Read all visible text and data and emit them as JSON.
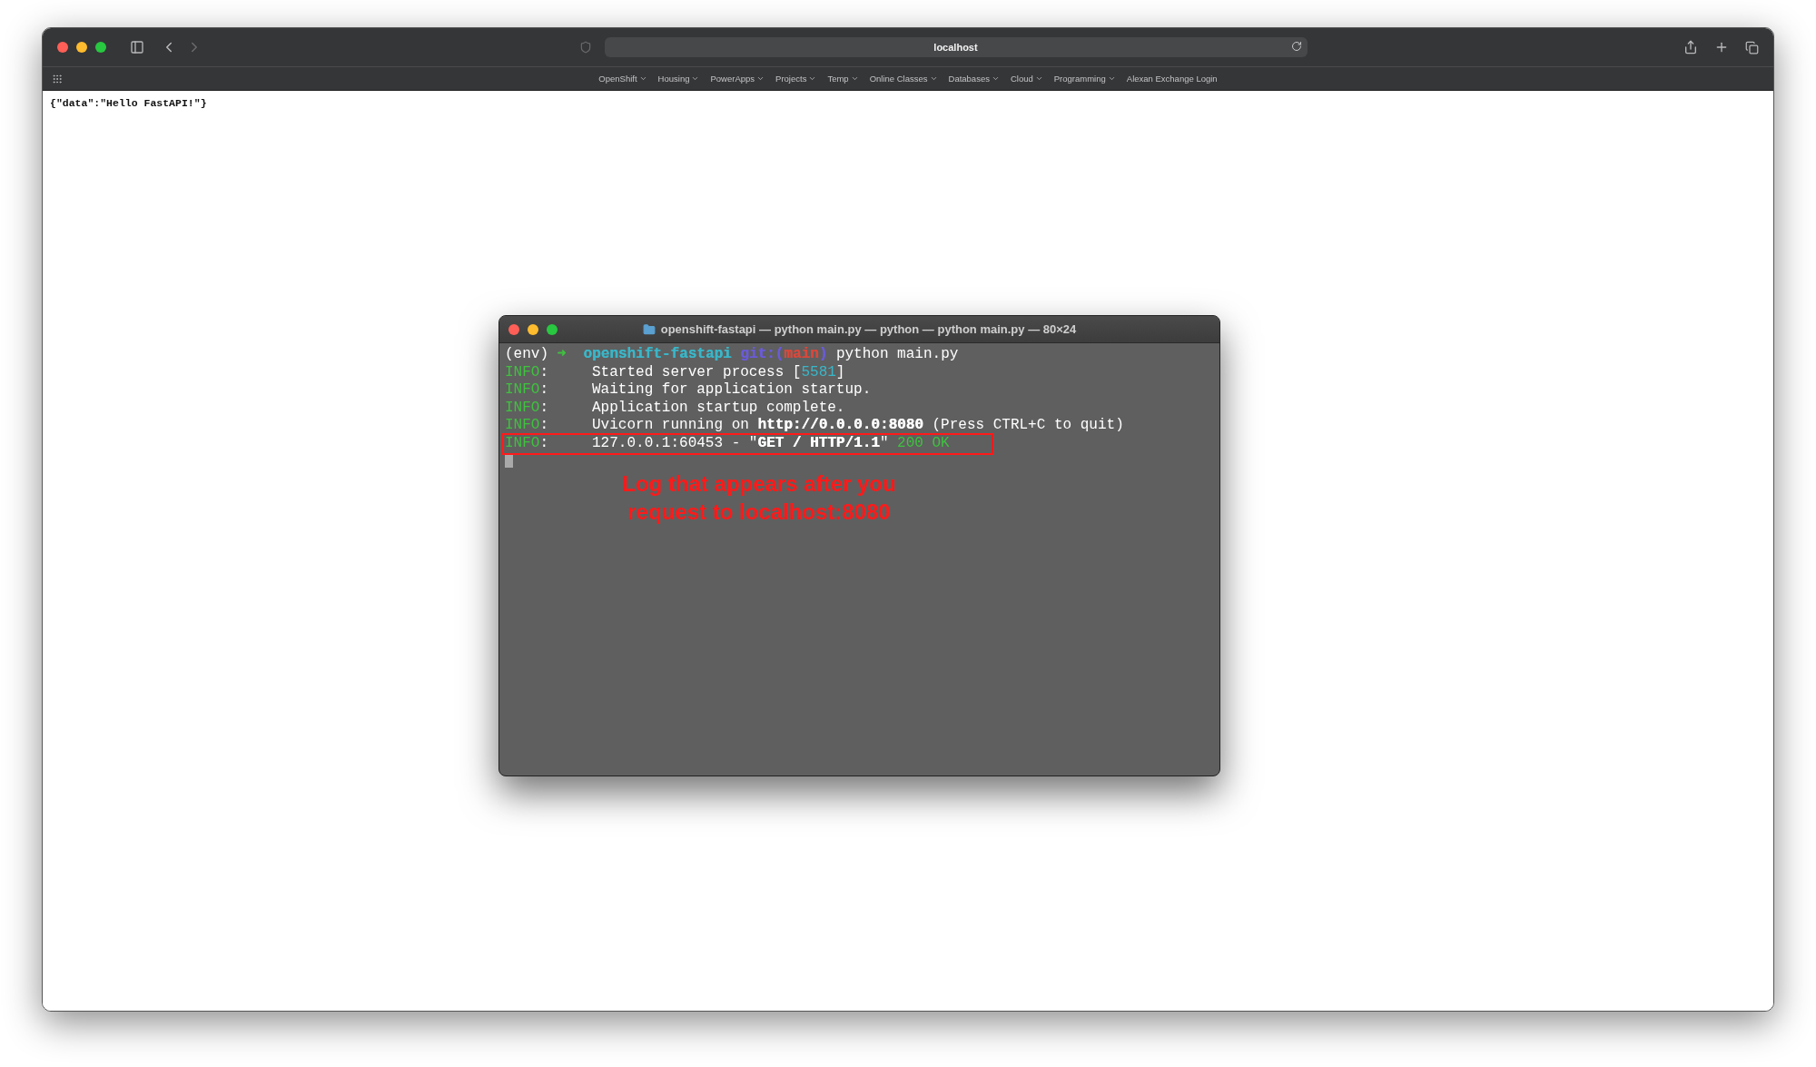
{
  "browser": {
    "url": "localhost",
    "bookmarks": [
      {
        "label": "OpenShift",
        "kind": "folder"
      },
      {
        "label": "Housing",
        "kind": "folder"
      },
      {
        "label": "PowerApps",
        "kind": "folder"
      },
      {
        "label": "Projects",
        "kind": "folder"
      },
      {
        "label": "Temp",
        "kind": "folder"
      },
      {
        "label": "Online Classes",
        "kind": "folder"
      },
      {
        "label": "Databases",
        "kind": "folder"
      },
      {
        "label": "Cloud",
        "kind": "folder"
      },
      {
        "label": "Programming",
        "kind": "folder"
      },
      {
        "label": "Alexan Exchange Login",
        "kind": "link"
      }
    ],
    "page_text": "{\"data\":\"Hello FastAPI!\"}"
  },
  "terminal": {
    "title": "openshift-fastapi — python main.py — python — python main.py — 80×24",
    "lines": [
      {
        "highlighted": false,
        "segments": [
          {
            "text": "(env) ",
            "color": "#ffffff",
            "bold": false
          },
          {
            "text": "➜  ",
            "color": "#3fc23f",
            "bold": true
          },
          {
            "text": "openshift-fastapi ",
            "color": "#3ab6c8",
            "bold": true
          },
          {
            "text": "git:(",
            "color": "#6a5bd8",
            "bold": true
          },
          {
            "text": "main",
            "color": "#d9483b",
            "bold": true
          },
          {
            "text": ") ",
            "color": "#6a5bd8",
            "bold": true
          },
          {
            "text": "python main.py",
            "color": "#ffffff",
            "bold": false
          }
        ]
      },
      {
        "highlighted": false,
        "segments": [
          {
            "text": "INFO",
            "color": "#3fc23f",
            "bold": false
          },
          {
            "text": ":     Started server process [",
            "color": "#ffffff",
            "bold": false
          },
          {
            "text": "5581",
            "color": "#3ab6c8",
            "bold": false
          },
          {
            "text": "]",
            "color": "#ffffff",
            "bold": false
          }
        ]
      },
      {
        "highlighted": false,
        "segments": [
          {
            "text": "INFO",
            "color": "#3fc23f",
            "bold": false
          },
          {
            "text": ":     Waiting for application startup.",
            "color": "#ffffff",
            "bold": false
          }
        ]
      },
      {
        "highlighted": false,
        "segments": [
          {
            "text": "INFO",
            "color": "#3fc23f",
            "bold": false
          },
          {
            "text": ":     Application startup complete.",
            "color": "#ffffff",
            "bold": false
          }
        ]
      },
      {
        "highlighted": false,
        "segments": [
          {
            "text": "INFO",
            "color": "#3fc23f",
            "bold": false
          },
          {
            "text": ":     Uvicorn running on ",
            "color": "#ffffff",
            "bold": false
          },
          {
            "text": "http://0.0.0.0:8080",
            "color": "#ffffff",
            "bold": true
          },
          {
            "text": " (Press CTRL+C to quit)",
            "color": "#ffffff",
            "bold": false
          }
        ]
      },
      {
        "highlighted": true,
        "segments": [
          {
            "text": "INFO",
            "color": "#3fc23f",
            "bold": false
          },
          {
            "text": ":     127.0.0.1:60453 - \"",
            "color": "#ffffff",
            "bold": false
          },
          {
            "text": "GET / HTTP/1.1",
            "color": "#ffffff",
            "bold": true
          },
          {
            "text": "\" ",
            "color": "#ffffff",
            "bold": false
          },
          {
            "text": "200 OK",
            "color": "#3fc23f",
            "bold": false
          }
        ]
      }
    ],
    "annotation": "Log that appears after you request to localhost:8080"
  }
}
